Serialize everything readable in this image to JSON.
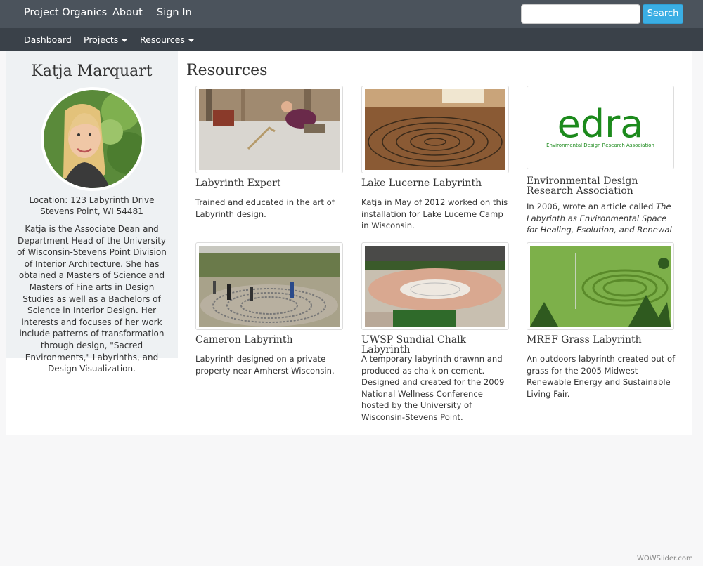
{
  "topbar": {
    "brand": "Project Organics",
    "about": "About",
    "signin": "Sign In",
    "search_placeholder": "",
    "search_button": "Search"
  },
  "subnav": {
    "dashboard": "Dashboard",
    "projects": "Projects",
    "resources": "Resources"
  },
  "profile": {
    "name": "Katja Marquart",
    "location_line1": "Location: 123 Labyrinth Drive",
    "location_line2": "Stevens Point, WI 54481",
    "bio": "Katja is the Associate Dean and Department Head of the University of Wisconsin-Stevens Point Division of Interior Architecture. She has obtained a Masters of Science and Masters of Fine arts in Design Studies as well as a Bachelors of Science in Interior Design. Her interests and focuses of her work include patterns of transformation through design, \"Sacred Environments,\" Labyrinths, and Design Visualization."
  },
  "page_title": "Resources",
  "resources": [
    {
      "title": "Labyrinth Expert",
      "desc": "Trained and educated in the art of Labyrinth design."
    },
    {
      "title": "Lake Lucerne Labyrinth",
      "desc": "Katja in May of 2012 worked on this installation for Lake Lucerne Camp in Wisconsin."
    },
    {
      "title": "Environmental Design Research Association",
      "desc_prefix": "In 2006, wrote an article called ",
      "desc_italic": "The Labyrinth as Environmental Space for Healing, Esolution, and Renewal",
      "logo_word": "edra",
      "logo_sub": "Environmental Design Research Association"
    },
    {
      "title": "Cameron Labyrinth",
      "desc": "Labyrinth designed on a private property near Amherst Wisconsin."
    },
    {
      "title": "UWSP Sundial Chalk Labyrinth",
      "desc": "A temporary labyrinth drawnn and produced as chalk on cement. Designed and created for the 2009 National Wellness Conference hosted by the University of Wisconsin-Stevens Point."
    },
    {
      "title": "MREF Grass Labyrinth",
      "desc": "An outdoors labyrinth created out of grass for the 2005 Midwest Renewable Energy and Sustainable Living Fair."
    }
  ],
  "watermark": "WOWSlider.com",
  "colors": {
    "topbar": "#4b535c",
    "subbar": "#3a4149",
    "search_button": "#3aaee4",
    "edra_green": "#1c8a1c"
  }
}
